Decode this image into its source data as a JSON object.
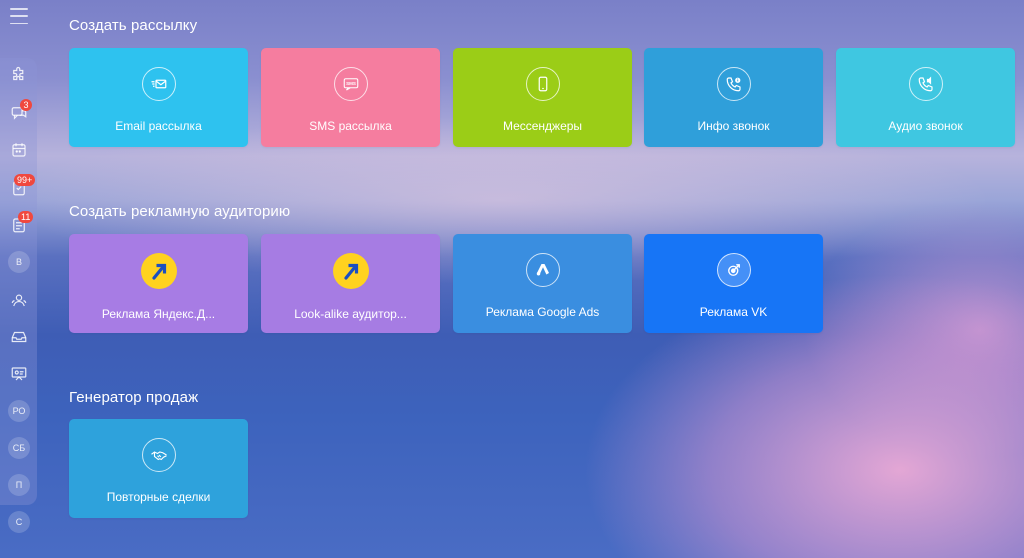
{
  "sidebar": {
    "menu_icon": "hamburger-icon",
    "items": [
      {
        "icon": "puzzle-icon"
      },
      {
        "icon": "chat-icon",
        "badge": "3"
      },
      {
        "icon": "calendar-icon"
      },
      {
        "icon": "tasks-icon",
        "badge": "99+"
      },
      {
        "icon": "document-icon",
        "badge": "11"
      },
      {
        "avatar": "В"
      },
      {
        "icon": "contacts-icon"
      },
      {
        "icon": "inbox-icon"
      },
      {
        "icon": "presentation-icon"
      },
      {
        "avatar": "РО"
      },
      {
        "avatar": "СБ"
      },
      {
        "avatar": "П"
      },
      {
        "avatar": "С"
      }
    ]
  },
  "sections": [
    {
      "title": "Создать рассылку",
      "tiles": [
        {
          "label": "Email рассылка",
          "icon": "email-send-icon",
          "color": "#2ec2ef"
        },
        {
          "label": "SMS рассылка",
          "icon": "sms-icon",
          "color": "#f57d9f"
        },
        {
          "label": "Мессенджеры",
          "icon": "smartphone-icon",
          "color": "#9bcd17"
        },
        {
          "label": "Инфо звонок",
          "icon": "phone-info-icon",
          "color": "#2f9fda"
        },
        {
          "label": "Аудио звонок",
          "icon": "phone-audio-icon",
          "color": "#3fc7e1"
        }
      ]
    },
    {
      "title": "Создать рекламную аудиторию",
      "tiles": [
        {
          "label": "Реклама Яндекс.Д...",
          "icon": "yandex-direct-icon",
          "color": "#a77ce4"
        },
        {
          "label": "Look-alike аудитор...",
          "icon": "yandex-direct-icon",
          "color": "#a67ce3"
        },
        {
          "label": "Реклама Google Ads",
          "icon": "google-ads-icon",
          "color": "#3a8ee0"
        },
        {
          "label": "Реклама VK",
          "icon": "vk-target-icon",
          "color": "#1775f6"
        }
      ]
    },
    {
      "title": "Генератор продаж",
      "tiles": [
        {
          "label": "Повторные сделки",
          "icon": "handshake-icon",
          "color": "#2ea2dc"
        }
      ]
    }
  ]
}
